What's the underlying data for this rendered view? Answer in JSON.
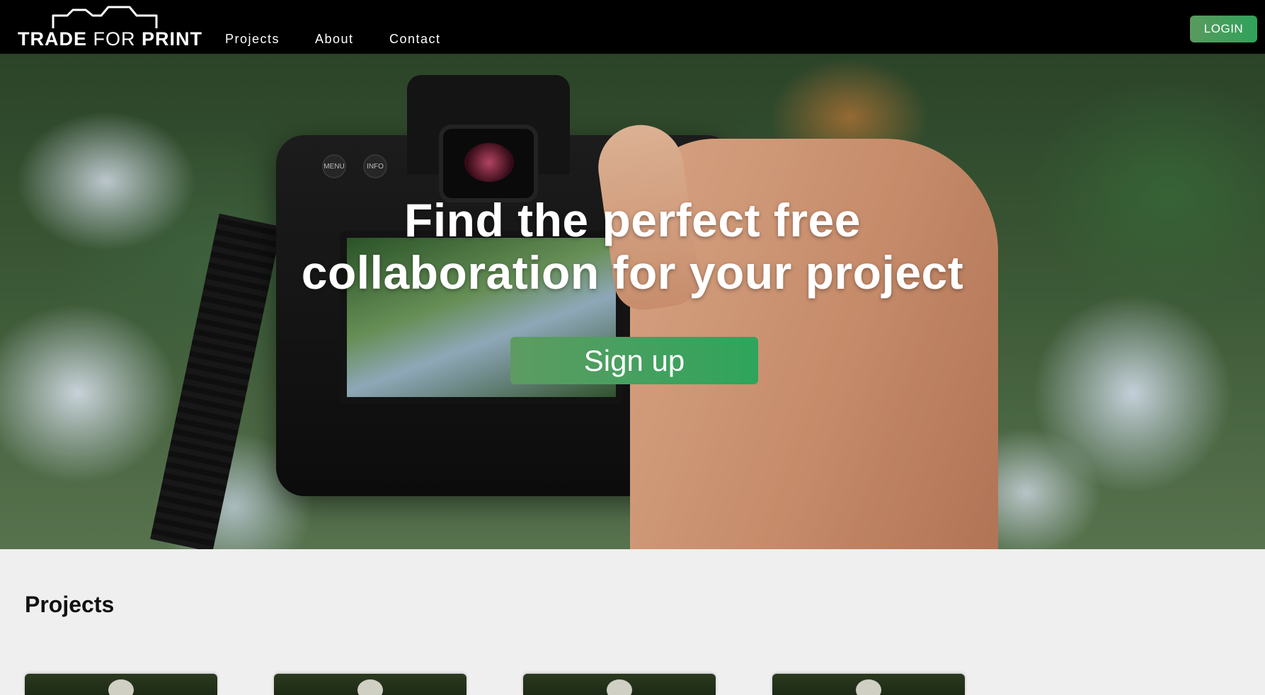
{
  "brand": {
    "logo_bold_1": "TRADE",
    "logo_light": "FOR",
    "logo_bold_2": "PRINT"
  },
  "nav": {
    "items": [
      {
        "label": "Projects"
      },
      {
        "label": "About"
      },
      {
        "label": "Contact"
      }
    ],
    "login_label": "LOGIN"
  },
  "hero": {
    "title_line1": "Find the perfect free",
    "title_line2": "collaboration for your project",
    "cta_label": "Sign up",
    "camera_labels": {
      "menu": "MENU",
      "info": "INFO"
    }
  },
  "projects": {
    "heading": "Projects",
    "card_count_visible": 4
  },
  "colors": {
    "navbar_bg": "#000000",
    "accent_green": "#2fa25a",
    "page_bg": "#efefef"
  }
}
